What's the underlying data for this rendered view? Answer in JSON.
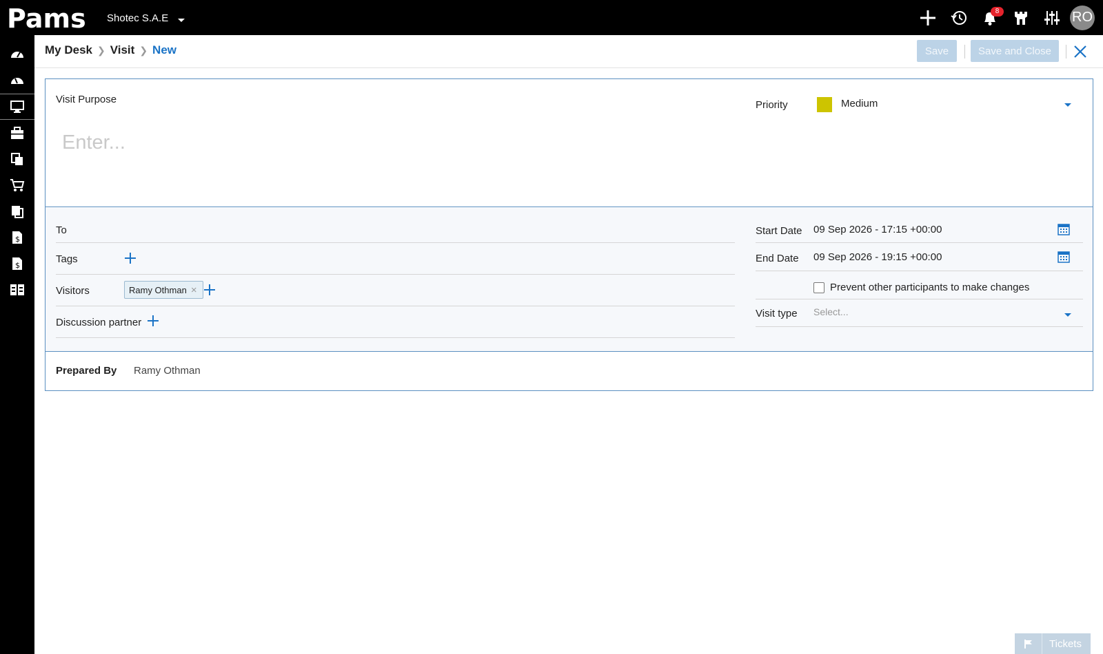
{
  "brand": "Pams",
  "company": "Shotec S.A.E",
  "notifications_count": "8",
  "user_initials": "RO",
  "breadcrumb": [
    "My Desk",
    "Visit",
    "New"
  ],
  "actions": {
    "save": "Save",
    "save_close": "Save and Close"
  },
  "form": {
    "visit_purpose_label": "Visit Purpose",
    "visit_purpose_placeholder": "Enter...",
    "priority_label": "Priority",
    "priority_value": "Medium",
    "priority_color": "#cdc400",
    "to_label": "To",
    "tags_label": "Tags",
    "visitors_label": "Visitors",
    "visitor_chip": "Ramy Othman",
    "discussion_label": "Discussion partner",
    "start_date_label": "Start Date",
    "start_date_value": "09 Sep 2026 - 17:15 +00:00",
    "end_date_label": "End Date",
    "end_date_value": "09 Sep 2026 - 19:15 +00:00",
    "prevent_label": "Prevent other participants to make changes",
    "visit_type_label": "Visit type",
    "visit_type_placeholder": "Select...",
    "prepared_by_label": "Prepared By",
    "prepared_by_value": "Ramy Othman"
  },
  "tickets_label": "Tickets",
  "colors": {
    "accent": "#1a73c6",
    "card_border": "#5a8fc0",
    "disabled_btn": "#bcd3e7"
  }
}
